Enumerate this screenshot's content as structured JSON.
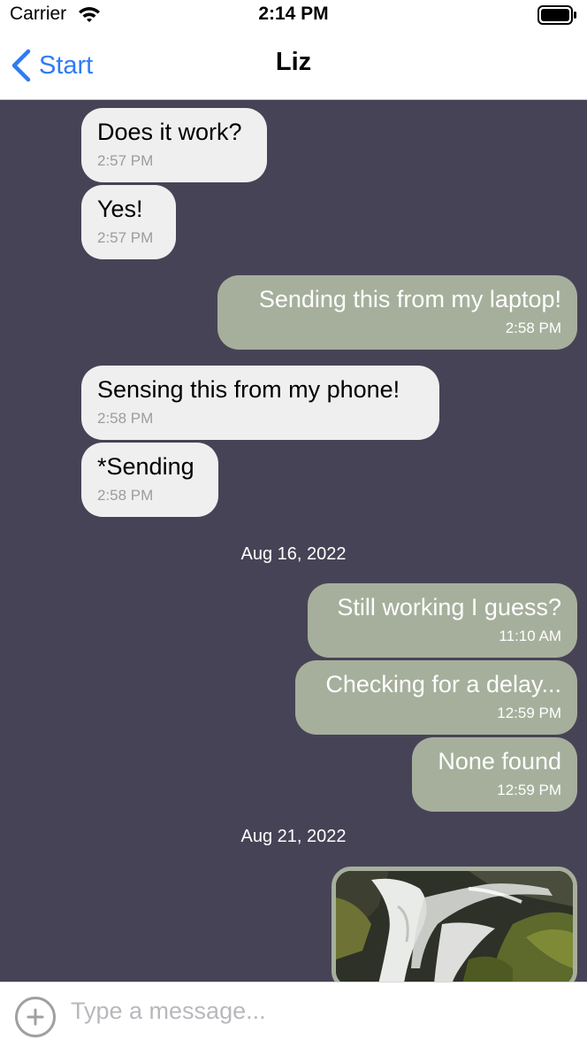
{
  "status_bar": {
    "carrier": "Carrier",
    "time": "2:14 PM",
    "icons": [
      "wifi-icon",
      "battery-icon"
    ]
  },
  "nav": {
    "back_label": "Start",
    "title": "Liz"
  },
  "colors": {
    "chat_background": "#474356",
    "incoming_bubble": "#efefef",
    "outgoing_bubble": "#a6af9c",
    "accent": "#2f7bf5"
  },
  "messages": [
    {
      "direction": "in",
      "text": "Does it work?",
      "time": "2:57 PM"
    },
    {
      "direction": "in",
      "text": "Yes!",
      "time": "2:57 PM"
    },
    {
      "direction": "out",
      "text": "Sending this from my laptop!",
      "time": "2:58 PM"
    },
    {
      "direction": "in",
      "text": "Sensing this from my phone!",
      "time": "2:58 PM"
    },
    {
      "direction": "in",
      "text": "*Sending",
      "time": "2:58 PM"
    },
    {
      "direction": "out",
      "text": "Still working I guess?",
      "time": "11:10 AM"
    },
    {
      "direction": "out",
      "text": "Checking for a delay...",
      "time": "12:59 PM"
    },
    {
      "direction": "out",
      "text": "None found",
      "time": "12:59 PM"
    }
  ],
  "date_separators": [
    "Aug 16, 2022",
    "Aug 21, 2022"
  ],
  "image_message": {
    "icon": "waterfall-photo"
  },
  "input": {
    "placeholder": "Type a message...",
    "value": "",
    "add_icon": "plus-circle-icon"
  }
}
